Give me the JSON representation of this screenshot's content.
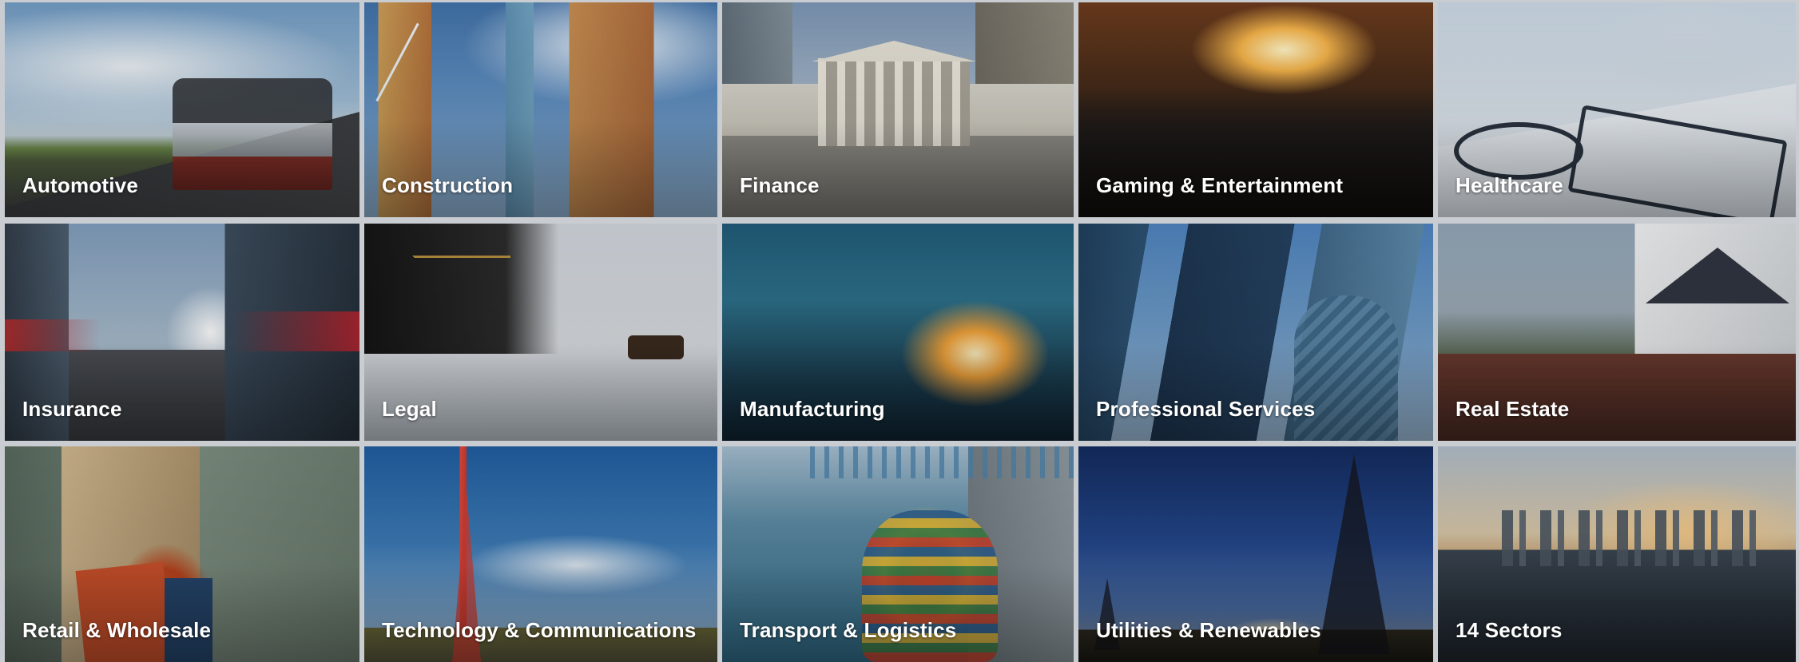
{
  "sectors": [
    {
      "label": "Automotive"
    },
    {
      "label": "Construction"
    },
    {
      "label": "Finance"
    },
    {
      "label": "Gaming & Entertainment"
    },
    {
      "label": "Healthcare"
    },
    {
      "label": "Insurance"
    },
    {
      "label": "Legal"
    },
    {
      "label": "Manufacturing"
    },
    {
      "label": "Professional Services"
    },
    {
      "label": "Real Estate"
    },
    {
      "label": "Retail & Wholesale"
    },
    {
      "label": "Technology & Communications"
    },
    {
      "label": "Transport & Logistics"
    },
    {
      "label": "Utilities & Renewables"
    },
    {
      "label": "14 Sectors"
    }
  ]
}
